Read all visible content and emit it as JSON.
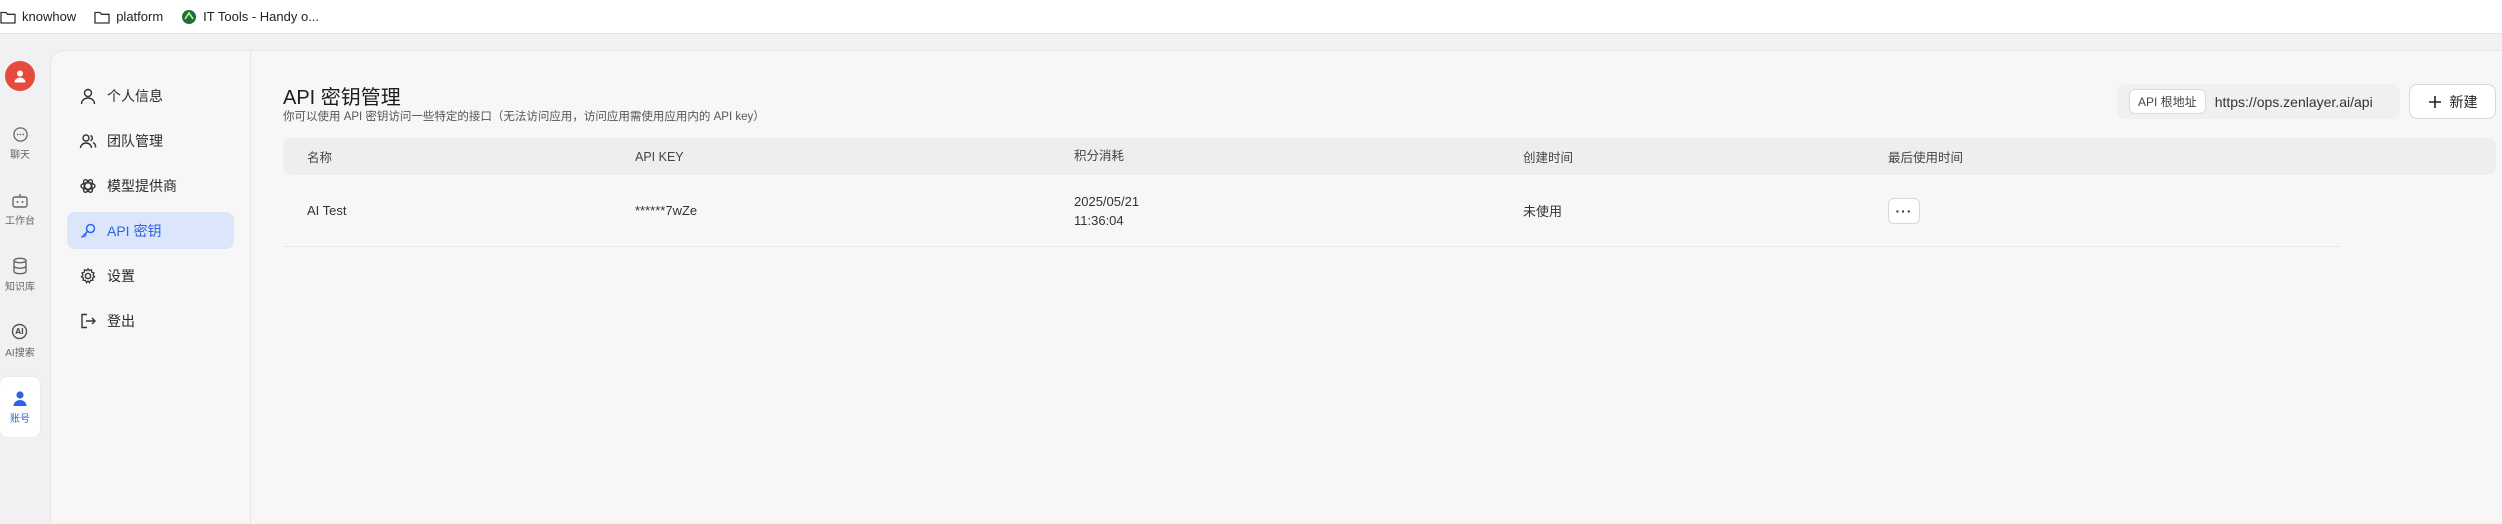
{
  "bookmarks": [
    {
      "label": "knowhow",
      "icon": "folder-icon"
    },
    {
      "label": "platform",
      "icon": "folder-icon"
    },
    {
      "label": "IT Tools - Handy o...",
      "icon": "it-tools-icon"
    }
  ],
  "rail": {
    "items": [
      {
        "label": "聊天",
        "icon": "chat-icon"
      },
      {
        "label": "工作台",
        "icon": "robot-icon"
      },
      {
        "label": "知识库",
        "icon": "database-icon"
      },
      {
        "label": "AI搜索",
        "icon": "ai-search-icon"
      },
      {
        "label": "账号",
        "icon": "user-icon",
        "active": true
      }
    ]
  },
  "settings_nav": {
    "items": [
      {
        "label": "个人信息",
        "icon": "user-icon"
      },
      {
        "label": "团队管理",
        "icon": "users-icon"
      },
      {
        "label": "模型提供商",
        "icon": "openai-icon"
      },
      {
        "label": "API 密钥",
        "icon": "key-icon",
        "active": true
      },
      {
        "label": "设置",
        "icon": "gear-icon"
      },
      {
        "label": "登出",
        "icon": "logout-icon"
      }
    ]
  },
  "page": {
    "title": "API 密钥管理",
    "subtitle": "你可以使用 API 密钥访问一些特定的接口（无法访问应用，访问应用需使用应用内的 API key）",
    "base_url_tag": "API 根地址",
    "base_url": "https://ops.zenlayer.ai/api",
    "new_button": "新建"
  },
  "table": {
    "columns": [
      "名称",
      "API KEY",
      "积分消耗",
      "创建时间",
      "最后使用时间"
    ],
    "rows": [
      {
        "name": "AI Test",
        "api_key": "******7wZe",
        "credits_line1": "2025/05/21",
        "credits_line2": "11:36:04",
        "created": "未使用",
        "more": "···"
      }
    ]
  },
  "colors": {
    "accent": "#2e63e6",
    "active_bg": "#dce6fb",
    "avatar": "#e54b3c"
  }
}
